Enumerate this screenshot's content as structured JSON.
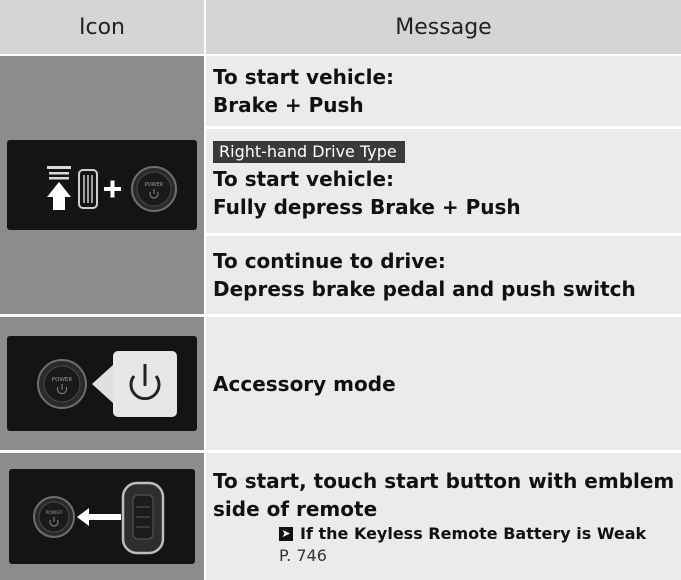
{
  "header": {
    "icon_label": "Icon",
    "message_label": "Message"
  },
  "rows": [
    {
      "icon": "brake-plus-power-button-icon",
      "messages": [
        {
          "line1": "To start vehicle:",
          "line2": "Brake + Push"
        },
        {
          "tag": "Right-hand Drive Type",
          "line1": "To start vehicle:",
          "line2": "Fully depress Brake + Push"
        },
        {
          "line1": "To continue to drive:",
          "line2": "Depress brake pedal and push switch"
        }
      ]
    },
    {
      "icon": "power-button-accessory-icon",
      "messages": [
        {
          "line1": "Accessory mode"
        }
      ]
    },
    {
      "icon": "power-button-remote-icon",
      "messages": [
        {
          "line1": "To start, touch start button with emblem",
          "line2": "side of remote",
          "ref_text": "If the Keyless Remote Battery is Weak",
          "ref_page": "P. 746"
        }
      ]
    }
  ],
  "button_text": "POWER"
}
